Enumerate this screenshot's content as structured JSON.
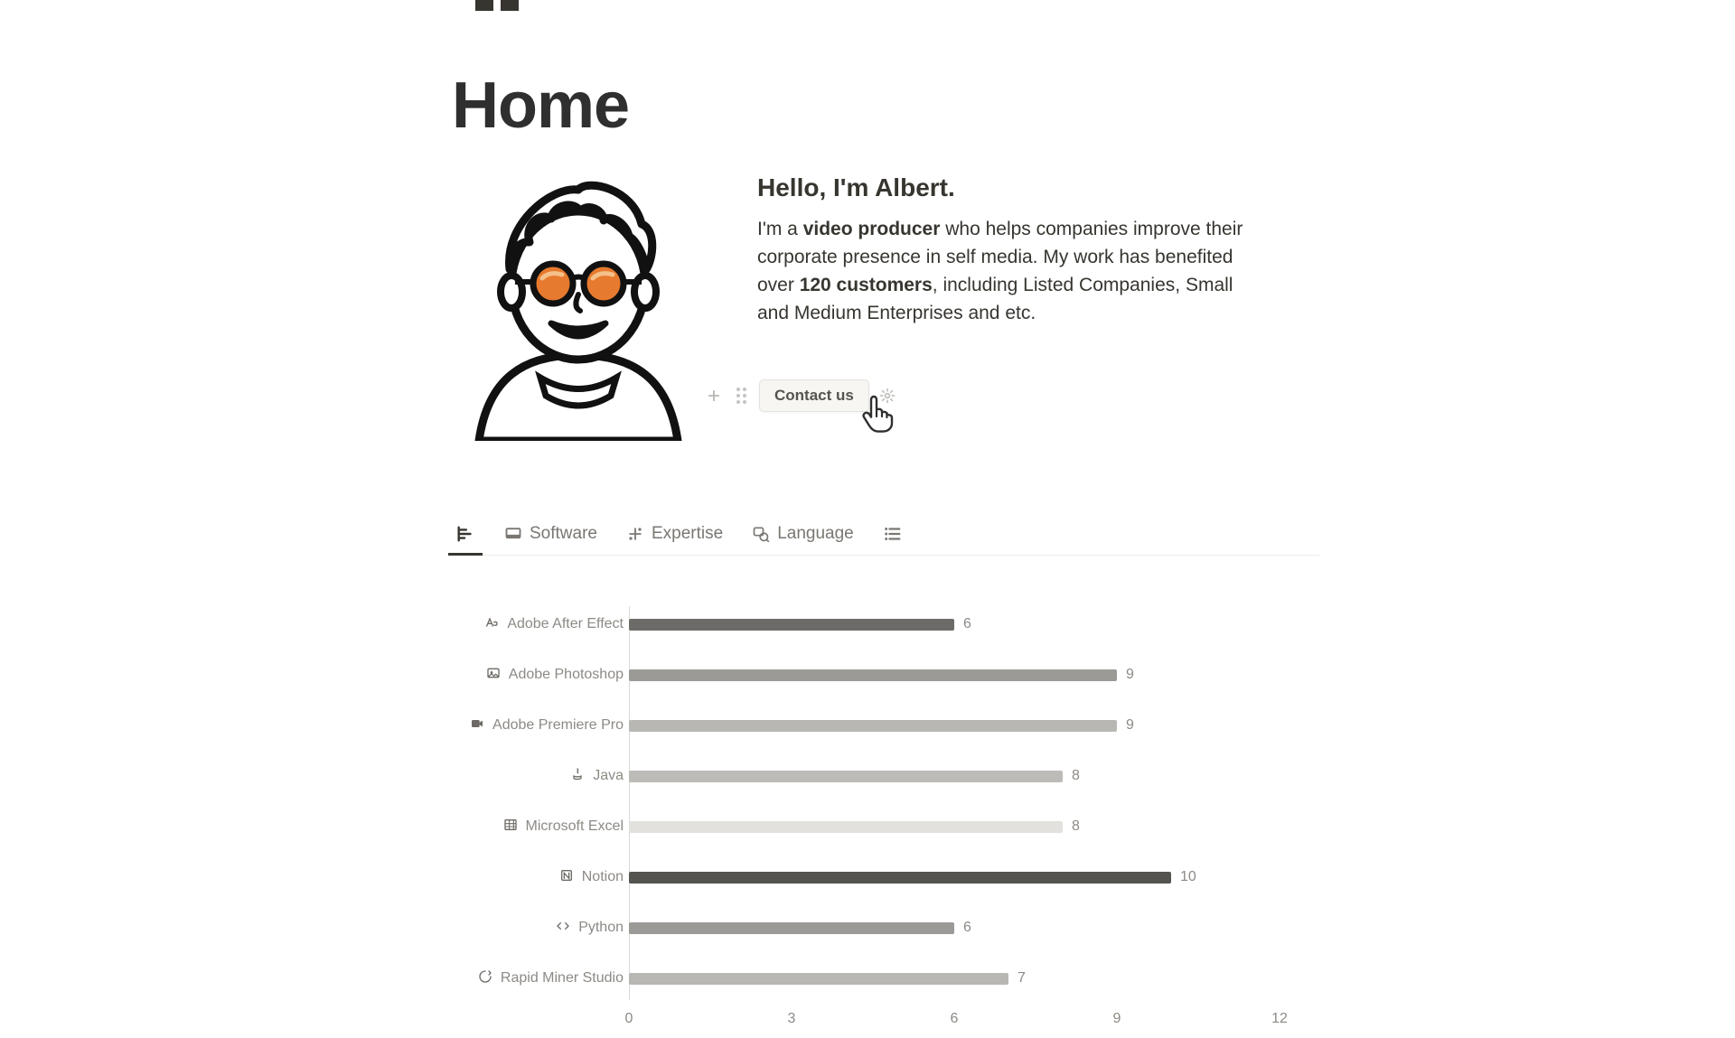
{
  "page": {
    "title": "Home"
  },
  "intro": {
    "hello": "Hello, I'm Albert.",
    "p_pre": "I'm a ",
    "p_bold1": "video producer",
    "p_mid": " who helps companies improve their corporate presence in self media. My work has benefited over ",
    "p_bold2": "120 customers",
    "p_end": ", including Listed Companies, Small and Medium Enterprises and etc."
  },
  "actions": {
    "contact_label": "Contact us"
  },
  "tabs": {
    "items": [
      {
        "label": ""
      },
      {
        "label": "Software"
      },
      {
        "label": "Expertise"
      },
      {
        "label": "Language"
      },
      {
        "label": ""
      }
    ]
  },
  "chart_data": {
    "type": "bar",
    "orientation": "horizontal",
    "title": "",
    "xlabel": "",
    "ylabel": "",
    "xlim": [
      0,
      12
    ],
    "x_ticks": [
      0,
      3,
      6,
      9,
      12
    ],
    "categories": [
      "Adobe After Effect",
      "Adobe Photoshop",
      "Adobe Premiere Pro",
      "Java",
      "Microsoft Excel",
      "Notion",
      "Python",
      "Rapid Miner Studio"
    ],
    "icons": [
      "after-effects-icon",
      "photoshop-icon",
      "premiere-icon",
      "java-icon",
      "excel-icon",
      "notion-icon",
      "code-icon",
      "rapidminer-icon"
    ],
    "values": [
      6,
      9,
      9,
      8,
      8,
      10,
      6,
      7
    ],
    "bar_colors": [
      "#6d6b68",
      "#9c9a96",
      "#b9b7b3",
      "#bdbbb7",
      "#e2e1dd",
      "#555350",
      "#9c9a96",
      "#b9b7b3"
    ]
  }
}
